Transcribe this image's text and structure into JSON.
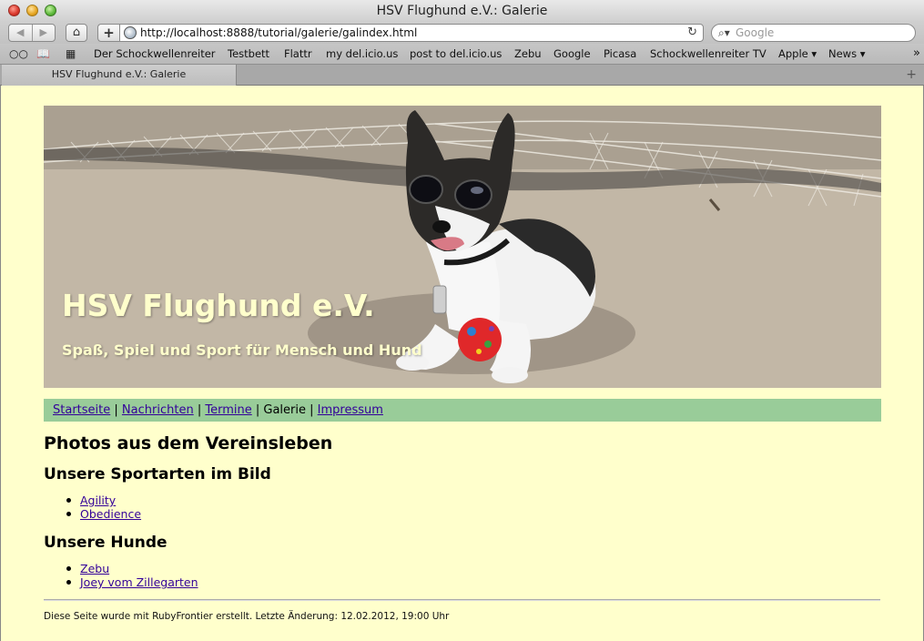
{
  "window": {
    "title": "HSV Flughund e.V.: Galerie",
    "url": "http://localhost:8888/tutorial/galerie/galindex.html",
    "search_placeholder": "Google",
    "tab_title": "HSV Flughund e.V.: Galerie"
  },
  "bookmarks": [
    "Der Schockwellenreiter",
    "Testbett",
    "Flattr",
    "my del.icio.us",
    "post to del.icio.us",
    "Zebu",
    "Google",
    "Picasa",
    "Schockwellenreiter TV",
    "Apple ▾",
    "News ▾"
  ],
  "hero": {
    "title": "HSV Flughund e.V.",
    "subtitle": "Spaß, Spiel und Sport für Mensch und Hund"
  },
  "nav": {
    "startseite": "Startseite",
    "nachrichten": "Nachrichten",
    "termine": "Termine",
    "galerie": "Galerie",
    "impressum": "Impressum",
    "separator": "|"
  },
  "content": {
    "heading": "Photos aus dem Vereinsleben",
    "section1": {
      "heading": "Unsere Sportarten im Bild",
      "items": [
        "Agility",
        "Obedience"
      ]
    },
    "section2": {
      "heading": "Unsere Hunde",
      "items": [
        "Zebu",
        "Joey vom Zillegarten"
      ]
    }
  },
  "footer": "Diese Seite wurde mit RubyFrontier erstellt. Letzte Änderung: 12.02.2012, 19:00 Uhr"
}
